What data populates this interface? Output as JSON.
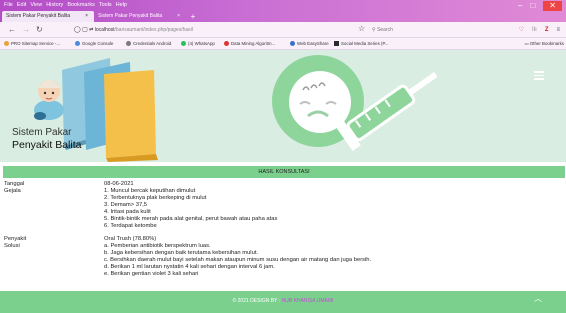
{
  "browser": {
    "menu": [
      "File",
      "Edit",
      "View",
      "History",
      "Bookmarks",
      "Tools",
      "Help"
    ],
    "tabs": [
      {
        "label": "Sistem Pakar Penyakit Balita",
        "active": true
      },
      {
        "label": "Sistem Pakar Penyakit Balita",
        "active": false
      }
    ],
    "url_host": "localhost",
    "url_path": "/barisaumani/index.php/pages/hasil",
    "search_placeholder": "Search",
    "bookmarks": [
      {
        "label": "PRO Sitemap Service -...",
        "color": "#e8a33a"
      },
      {
        "label": "Google Console",
        "color": "#4a8be0"
      },
      {
        "label": "Credentials Android",
        "color": "#7a7a7a"
      },
      {
        "label": "(4) WhatsApp",
        "color": "#25c15a"
      },
      {
        "label": "Data Mining Algoritm...",
        "color": "#d33"
      },
      {
        "label": "Web EasyShare",
        "color": "#3a6fc9"
      },
      {
        "label": "Social Media Series (P...",
        "color": "#2a2a2a"
      }
    ],
    "other_bookmarks": "Other Bookmarks"
  },
  "header": {
    "brand_line1": "Sistem Pakar",
    "brand_line2": "Penyakit Balita"
  },
  "result": {
    "title": "HASIL KONSULTASI",
    "tanggal_label": "Tanggal",
    "tanggal": "08-06-2021",
    "gejala_label": "Gejala",
    "gejala": [
      "1. Muncul bercak keputihan dimulut",
      "2. Terbentuknya plak berkeping di mulut",
      "3. Demam> 37,5",
      "4. Iritasi pada kulit",
      "5. Bintik-bintik merah pada alat genital, perut bawah atau paha atas",
      "6. Terdapat ketombe"
    ],
    "penyakit_label": "Penyakit",
    "penyakit": "Oral Trush (78.80%)",
    "solusi_label": "Solusi",
    "solusi": [
      "a. Pemberian antibiotik berspektrum luas.",
      "b. Jaga kebersihan dengan baik terutama kebersihan mulut.",
      "c. Bersihkan daerah mulut bayi setelah makan ataupun minum susu dengan air matang dan juga bersih.",
      "d. Berikan 1 ml larutan nystatin 4 kali sehari dengan interval 6 jam.",
      "e. Berikan gentian violet 3 kali sehari"
    ]
  },
  "footer": {
    "prefix": "© 2021 DESIGN BY :",
    "author": "NUR KHARISA UMAMI"
  },
  "colors": {
    "accent_green": "#7cd08e",
    "header_bg": "#d9ede2",
    "browser_purple": "#b34cc6"
  }
}
